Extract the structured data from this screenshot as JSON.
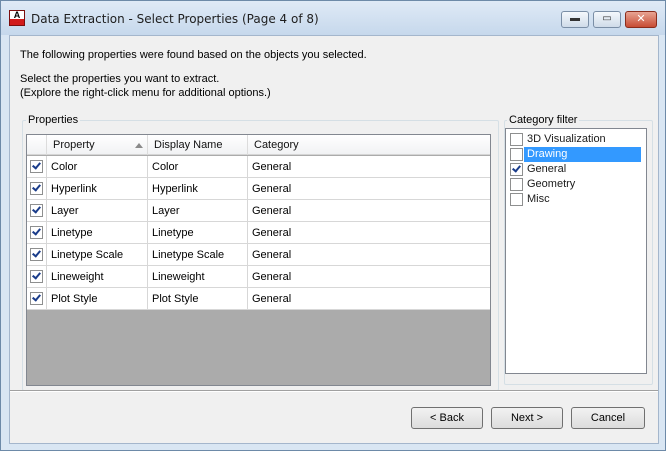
{
  "window": {
    "title": "Data Extraction - Select Properties (Page 4 of 8)",
    "app_icon_letter": "A",
    "buttons": {
      "minimize": "▬",
      "maximize": "▭",
      "close": "✕"
    }
  },
  "intro": {
    "line1": "The following properties were found based on the objects you selected.",
    "line2": "Select the properties you want to extract.",
    "line3": "(Explore the right-click menu for additional options.)"
  },
  "properties": {
    "group_label": "Properties",
    "columns": [
      "Property",
      "Display Name",
      "Category"
    ],
    "rows": [
      {
        "checked": true,
        "property": "Color",
        "display_name": "Color",
        "category": "General"
      },
      {
        "checked": true,
        "property": "Hyperlink",
        "display_name": "Hyperlink",
        "category": "General"
      },
      {
        "checked": true,
        "property": "Layer",
        "display_name": "Layer",
        "category": "General"
      },
      {
        "checked": true,
        "property": "Linetype",
        "display_name": "Linetype",
        "category": "General"
      },
      {
        "checked": true,
        "property": "Linetype Scale",
        "display_name": "Linetype Scale",
        "category": "General"
      },
      {
        "checked": true,
        "property": "Lineweight",
        "display_name": "Lineweight",
        "category": "General"
      },
      {
        "checked": true,
        "property": "Plot Style",
        "display_name": "Plot Style",
        "category": "General"
      }
    ]
  },
  "category_filter": {
    "label": "Category filter",
    "items": [
      {
        "label": "3D Visualization",
        "checked": false,
        "selected": false
      },
      {
        "label": "Drawing",
        "checked": false,
        "selected": true
      },
      {
        "label": "General",
        "checked": true,
        "selected": false
      },
      {
        "label": "Geometry",
        "checked": false,
        "selected": false
      },
      {
        "label": "Misc",
        "checked": false,
        "selected": false
      }
    ]
  },
  "footer": {
    "back": "< Back",
    "next": "Next >",
    "cancel": "Cancel"
  },
  "colors": {
    "selection": "#3399ff",
    "check": "#1a3c8a",
    "grid_empty": "#ababab"
  }
}
